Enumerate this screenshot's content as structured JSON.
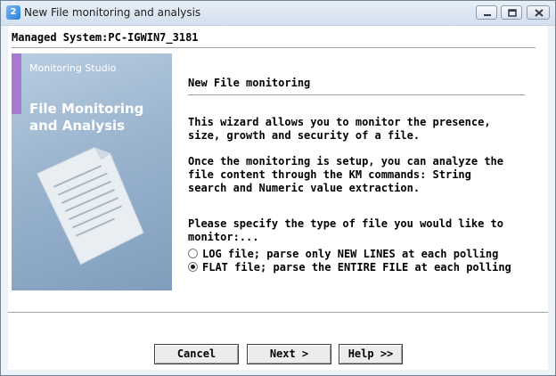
{
  "window": {
    "title": "New File monitoring and analysis",
    "icon": "app-icon"
  },
  "header": {
    "managed_system": "Managed System:PC-IGWIN7_3181"
  },
  "banner": {
    "studio": "Monitoring Studio",
    "title_line1": "File Monitoring",
    "title_line2": "and Analysis",
    "accent_color": "#a77bd2"
  },
  "main": {
    "heading": "New File monitoring",
    "para1": "This wizard allows you to monitor the presence,\nsize, growth and security of a file.",
    "para2": "Once the monitoring is setup, you can analyze the\nfile content through the KM commands: String\nsearch and Numeric value extraction.",
    "para3": "Please specify the type of file you would like to\nmonitor:...",
    "options": [
      {
        "label": "LOG file; parse only NEW LINES at each polling",
        "selected": false
      },
      {
        "label": "FLAT file; parse the ENTIRE FILE at each polling",
        "selected": true
      }
    ]
  },
  "buttons": {
    "cancel": "Cancel",
    "next": "Next >",
    "help": "Help >>"
  }
}
